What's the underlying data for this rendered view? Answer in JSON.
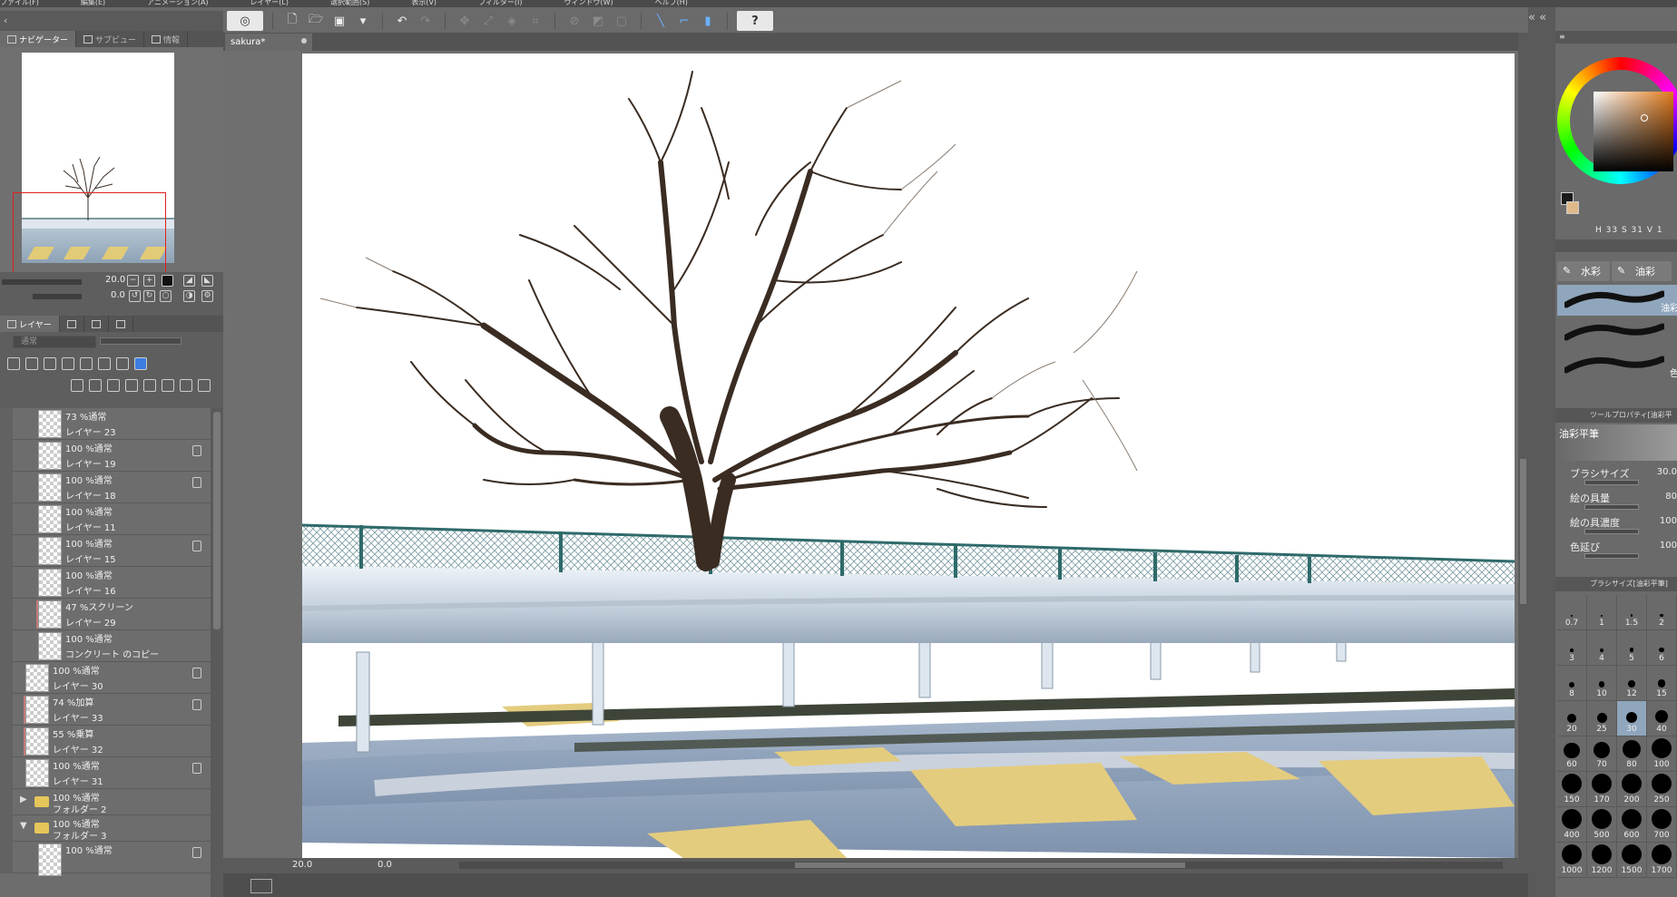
{
  "menu": [
    "ファイル(F)",
    "編集(E)",
    "アニメーション(A)",
    "レイヤー(L)",
    "選択範囲(S)",
    "表示(V)",
    "フィルター(I)",
    "ウィンドウ(W)",
    "ヘルプ(H)"
  ],
  "navigator": {
    "tabs": [
      "ナビゲーター",
      "サブビュー",
      "情報"
    ],
    "zoom": "20.0",
    "rotation": "0.0"
  },
  "layer_panel": {
    "tab": "レイヤー",
    "blend_mode": "通常",
    "layers": [
      {
        "blend": "73 %通常",
        "name": "レイヤー 23",
        "indent": 1,
        "lock": false,
        "mark": false
      },
      {
        "blend": "100 %通常",
        "name": "レイヤー 19",
        "indent": 1,
        "lock": true,
        "mark": false
      },
      {
        "blend": "100 %通常",
        "name": "レイヤー 18",
        "indent": 1,
        "lock": true,
        "mark": false
      },
      {
        "blend": "100 %通常",
        "name": "レイヤー 11",
        "indent": 1,
        "lock": false,
        "mark": false
      },
      {
        "blend": "100 %通常",
        "name": "レイヤー 15",
        "indent": 1,
        "lock": true,
        "mark": false
      },
      {
        "blend": "100 %通常",
        "name": "レイヤー 16",
        "indent": 1,
        "lock": false,
        "mark": false
      },
      {
        "blend": "47 %スクリーン",
        "name": "レイヤー 29",
        "indent": 1,
        "lock": false,
        "mark": true
      },
      {
        "blend": "100 %通常",
        "name": "コンクリート のコピー",
        "indent": 1,
        "lock": false,
        "mark": false
      },
      {
        "blend": "100 %通常",
        "name": "レイヤー 30",
        "indent": 0,
        "lock": true,
        "mark": false
      },
      {
        "blend": "74 %加算",
        "name": "レイヤー 33",
        "indent": 0,
        "lock": true,
        "mark": true
      },
      {
        "blend": "55 %乗算",
        "name": "レイヤー 32",
        "indent": 0,
        "lock": false,
        "mark": true
      },
      {
        "blend": "100 %通常",
        "name": "レイヤー 31",
        "indent": 0,
        "lock": true,
        "mark": false
      }
    ],
    "folders": [
      {
        "blend": "100 %通常",
        "name": "フォルダー 2",
        "arrow": "▶"
      },
      {
        "blend": "100 %通常",
        "name": "フォルダー 3",
        "arrow": "▼"
      }
    ],
    "last_partial": {
      "blend": "100 %通常"
    }
  },
  "document": {
    "tab_title": "sakura*"
  },
  "status": {
    "zoom": "20.0",
    "rotation": "0.0"
  },
  "toolbar": {
    "help": "?"
  },
  "color": {
    "main": "#1a1a1a",
    "sub": "#dfb98a",
    "hsv_label": "H 33 S 31 V 1"
  },
  "subtool": {
    "tabs": [
      "水彩",
      "油彩"
    ],
    "strokes": [
      {
        "label": "油彩",
        "active": true
      },
      {
        "label": "",
        "active": false
      },
      {
        "label": "色",
        "active": false
      }
    ]
  },
  "tool_property": {
    "header": "ツールプロパティ[油彩平",
    "brush": "油彩平筆",
    "props": [
      {
        "label": "ブラシサイズ",
        "value": "30.0"
      },
      {
        "label": "絵の具量",
        "value": "80"
      },
      {
        "label": "絵の具濃度",
        "value": "100"
      },
      {
        "label": "色延び",
        "value": "100"
      }
    ]
  },
  "brush_size": {
    "header": "ブラシサイズ[油彩平筆]",
    "sizes": [
      "0.7",
      "1",
      "1.5",
      "2",
      "3",
      "4",
      "5",
      "6",
      "8",
      "10",
      "12",
      "15",
      "20",
      "25",
      "30",
      "40",
      "60",
      "70",
      "80",
      "100",
      "150",
      "170",
      "200",
      "250",
      "400",
      "500",
      "600",
      "700",
      "1000",
      "1200",
      "1500",
      "1700"
    ],
    "selected": "30"
  }
}
